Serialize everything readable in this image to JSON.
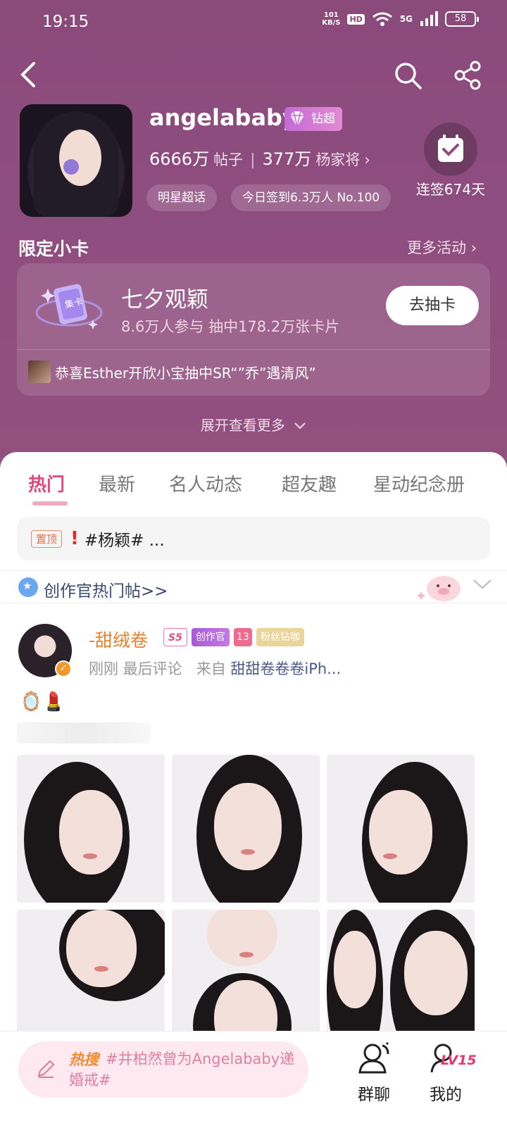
{
  "status": {
    "time": "19:15",
    "net_speed_top": "101",
    "net_speed_unit": "KB/S",
    "hd": "HD",
    "signal": "5G",
    "battery": "58"
  },
  "profile": {
    "name": "angelababy",
    "badge": "钻超",
    "posts_count": "6666万",
    "posts_label": "帖子",
    "fans_count": "377万",
    "fans_label": "杨家将",
    "pill_1": "明星超话",
    "pill_2": "今日签到6.3万人 No.100",
    "checkin_label": "连签674天"
  },
  "activity": {
    "section_title": "限定小卡",
    "more_label": "更多活动",
    "card_icon_text": "集卡",
    "card_title": "七夕观颖",
    "card_sub": "8.6万人参与 抽中178.2万张卡片",
    "draw_button": "去抽卡",
    "ticker": "恭喜Esther开欣小宝抽中SR“”乔”遇清风”",
    "expand": "展开查看更多"
  },
  "tabs": [
    "热门",
    "最新",
    "名人动态",
    "超友趣",
    "星动纪念册"
  ],
  "pinned": {
    "badge": "置顶",
    "text": "#杨颖# ..."
  },
  "hot_posts_label": "创作官热门帖>>",
  "post": {
    "author": "-甜绒卷",
    "badge_s5": "S5",
    "badge_creator": "创作官",
    "badge_gem": "13",
    "badge_fan": "粉丝钻咖",
    "meta_time": "刚刚 最后评论",
    "meta_from": "来自",
    "meta_source": "甜甜卷卷卷iPh...",
    "emojis": "🪞💄"
  },
  "bottom": {
    "hot_tag": "热搜",
    "hot_text": "#井柏然曾为Angelababy递婚戒#",
    "group_chat": "群聊",
    "mine": "我的",
    "level": "LV15"
  },
  "colors": {
    "hero": "#8e4d7f",
    "accent": "#e04a7a",
    "hot_search_bg": "#fde9ef"
  }
}
